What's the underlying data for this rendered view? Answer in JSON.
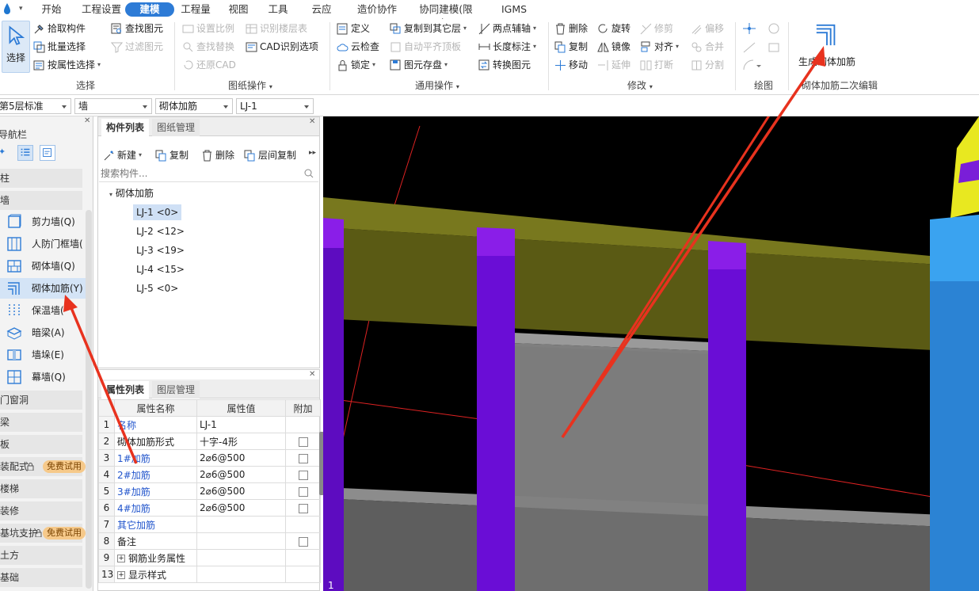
{
  "menu": {
    "items": [
      "开始",
      "工程设置",
      "建模",
      "工程量",
      "视图",
      "工具",
      "云应用",
      "造价协作",
      "协同建模(限免)",
      "IGMS"
    ],
    "active": "建模"
  },
  "ribbon": {
    "select_group": {
      "select_big": "选择",
      "pick": "拾取构件",
      "batch": "批量选择",
      "by_attr": "按属性选择",
      "find": "查找图元",
      "filter": "过滤图元",
      "label": "选择"
    },
    "drawing_group": {
      "set_scale": "设置比例",
      "find_replace": "查找替换",
      "restore_cad": "还原CAD",
      "identify_floor": "识别楼层表",
      "cad_options": "CAD识别选项",
      "label": "图纸操作"
    },
    "general_group": {
      "define": "定义",
      "cloud_check": "云检查",
      "lock": "锁定",
      "copy_to_floor": "复制到其它层",
      "auto_align": "自动平齐顶板",
      "save_element": "图元存盘",
      "two_point_axis": "两点辅轴",
      "length_dim": "长度标注",
      "convert_element": "转换图元",
      "label": "通用操作"
    },
    "modify_group": {
      "delete": "删除",
      "copy": "复制",
      "move": "移动",
      "rotate": "旋转",
      "mirror": "镜像",
      "extend": "延伸",
      "trim": "修剪",
      "align": "对齐",
      "break": "打断",
      "offset": "偏移",
      "merge": "合并",
      "split": "分割",
      "label": "修改"
    },
    "draw_group": {
      "label": "绘图"
    },
    "rebar_group": {
      "generate": "生成砌体加筋",
      "label": "砌体加筋二次编辑"
    }
  },
  "toolbar": {
    "floor": "第5层标准",
    "category": "墙",
    "type": "砌体加筋",
    "component": "LJ-1"
  },
  "nav": {
    "title": "导航栏",
    "categories": [
      "柱",
      "墙",
      "门窗洞",
      "梁",
      "板",
      "装配式",
      "楼梯",
      "装修",
      "基坑支护",
      "土方",
      "基础"
    ],
    "wall_items": [
      {
        "label": "剪力墙(Q)",
        "icon": "shear-wall-icon"
      },
      {
        "label": "人防门框墙(",
        "icon": "civil-defense-door-wall-icon"
      },
      {
        "label": "砌体墙(Q)",
        "icon": "masonry-wall-icon"
      },
      {
        "label": "砌体加筋(Y)",
        "icon": "masonry-rebar-icon"
      },
      {
        "label": "保温墙(",
        "icon": "insulation-wall-icon"
      },
      {
        "label": "暗梁(A)",
        "icon": "hidden-beam-icon"
      },
      {
        "label": "墙垛(E)",
        "icon": "wall-pier-icon"
      },
      {
        "label": "幕墙(Q)",
        "icon": "curtain-wall-icon"
      }
    ],
    "selected": "砌体加筋(Y)",
    "badge": "免费试用"
  },
  "component_panel": {
    "tab_list": "构件列表",
    "tab_drawings": "图纸管理",
    "new": "新建",
    "copy": "复制",
    "delete": "删除",
    "floor_copy": "层间复制",
    "search_placeholder": "搜索构件...",
    "root": "砌体加筋",
    "items": [
      "LJ-1 <0>",
      "LJ-2 <12>",
      "LJ-3 <19>",
      "LJ-4 <15>",
      "LJ-5 <0>"
    ],
    "selected": "LJ-1 <0>"
  },
  "property_panel": {
    "tab_props": "属性列表",
    "tab_layers": "图层管理",
    "headers": [
      "属性名称",
      "属性值",
      "附加"
    ],
    "rows": [
      {
        "no": "1",
        "name": "名称",
        "value": "LJ-1",
        "blue": true,
        "check": false
      },
      {
        "no": "2",
        "name": "砌体加筋形式",
        "value": "十字-4形",
        "blue": false,
        "check": true
      },
      {
        "no": "3",
        "name": "1#加筋",
        "value": "2⌀6@500",
        "blue": true,
        "check": true
      },
      {
        "no": "4",
        "name": "2#加筋",
        "value": "2⌀6@500",
        "blue": true,
        "check": true
      },
      {
        "no": "5",
        "name": "3#加筋",
        "value": "2⌀6@500",
        "blue": true,
        "check": true
      },
      {
        "no": "6",
        "name": "4#加筋",
        "value": "2⌀6@500",
        "blue": true,
        "check": true
      },
      {
        "no": "7",
        "name": "其它加筋",
        "value": "",
        "blue": true,
        "check": false
      },
      {
        "no": "8",
        "name": "备注",
        "value": "",
        "blue": false,
        "check": true
      },
      {
        "no": "9",
        "name": "钢筋业务属性",
        "value": "",
        "blue": false,
        "check": false,
        "expand": true
      },
      {
        "no": "13",
        "name": "显示样式",
        "value": "",
        "blue": false,
        "check": false,
        "expand": true
      }
    ]
  },
  "colors": {
    "accent": "#2d7bd6",
    "beam": "#5a5a14",
    "column": "#6a0dd6",
    "wall": "#8a8a8a",
    "column_right": "#2b8fe0",
    "arrow": "#e8321e"
  }
}
